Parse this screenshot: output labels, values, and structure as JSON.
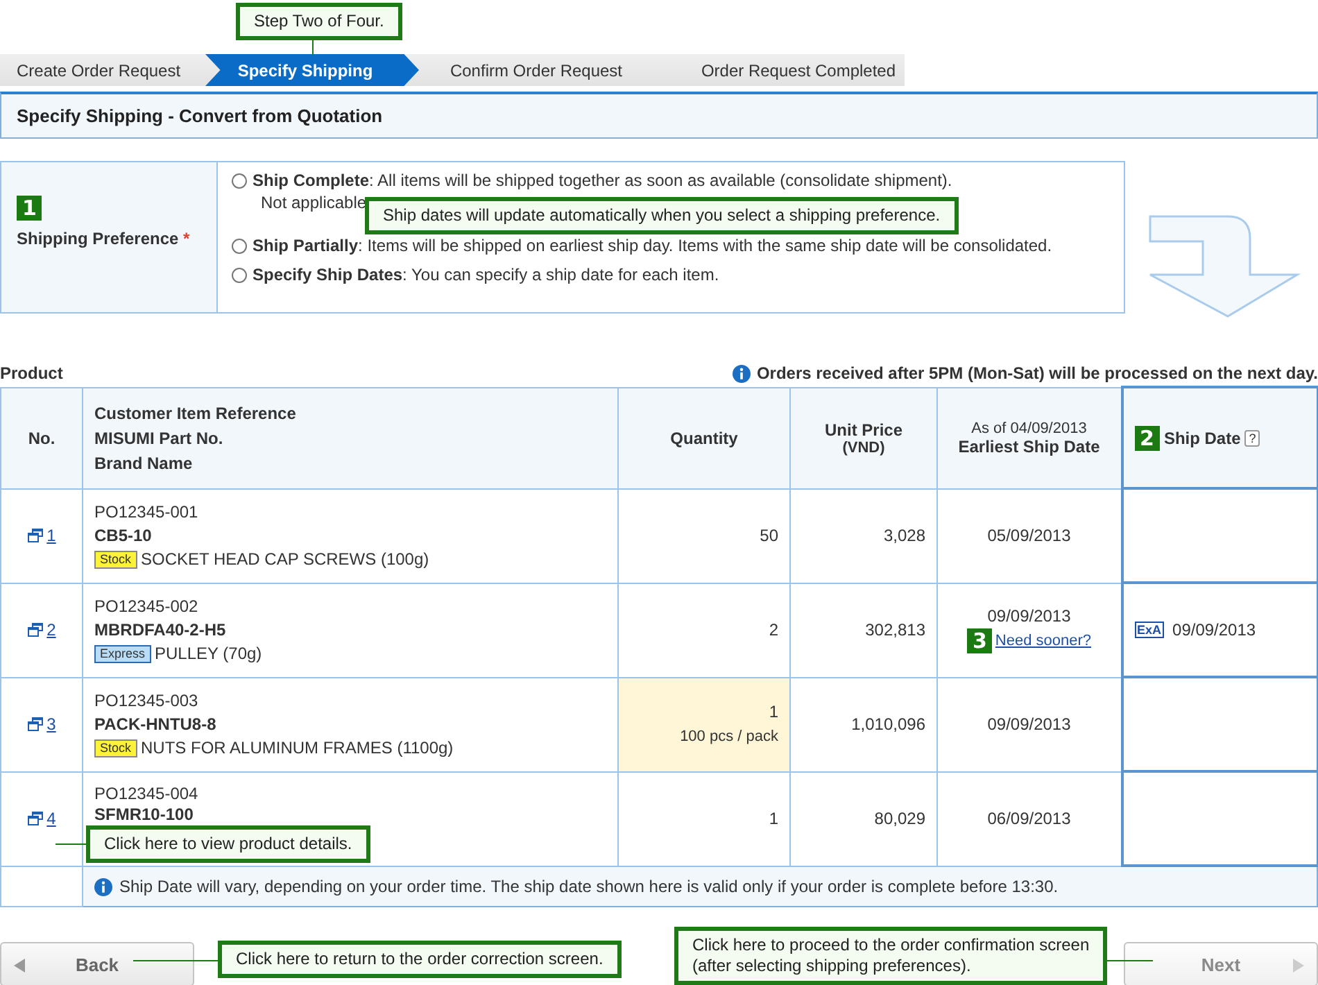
{
  "steps": [
    {
      "label": "Create Order Request",
      "selected": false
    },
    {
      "label": "Specify Shipping",
      "selected": true
    },
    {
      "label": "Confirm Order Request",
      "selected": false
    },
    {
      "label": "Order Request Completed",
      "selected": false
    }
  ],
  "page_title": "Specify Shipping - Convert from Quotation",
  "preference": {
    "marker": "1",
    "label": "Shipping Preference",
    "required_mark": "*",
    "options": [
      {
        "title": "Ship Complete",
        "text": ": All items will be shipped together as soon as available (consolidate shipment).",
        "note": "Not applicable",
        "selected": false
      },
      {
        "title": "Ship Partially",
        "text": ": Items will be shipped on earliest ship day. Items with the same ship date will be consolidated.",
        "selected": false
      },
      {
        "title": "Specify Ship Dates",
        "text": ": You can specify a ship date for each item.",
        "selected": false
      }
    ]
  },
  "product": {
    "title": "Product",
    "notice": "Orders received after 5PM (Mon-Sat) will be processed on the next day.",
    "columns": {
      "no": "No.",
      "item": [
        "Customer Item Reference",
        "MISUMI Part No.",
        "Brand Name"
      ],
      "quantity": "Quantity",
      "price": [
        "Unit Price",
        "(VND)"
      ],
      "earliest": [
        "As of 04/09/2013",
        "Earliest Ship Date"
      ],
      "ship_marker": "2",
      "ship_date": "Ship Date",
      "help": "?"
    },
    "rows": [
      {
        "no": "1",
        "reference": "PO12345-001",
        "part_no": "CB5-10",
        "tag": {
          "label": "Stock",
          "kind": "stock"
        },
        "name": "SOCKET HEAD CAP SCREWS (100g)",
        "quantity": "50",
        "highlighted": false,
        "unit_price": "3,028",
        "earliest": "05/09/2013"
      },
      {
        "no": "2",
        "reference": "PO12345-002",
        "part_no": "MBRDFA40-2-H5",
        "tag": {
          "label": "Express",
          "kind": "express"
        },
        "name": "PULLEY (70g)",
        "quantity": "2",
        "highlighted": false,
        "unit_price": "302,813",
        "earliest": "09/09/2013",
        "sooner_marker": "3",
        "sooner_link": "Need sooner?",
        "ship_badge": "ExA",
        "ship_date": "09/09/2013"
      },
      {
        "no": "3",
        "reference": "PO12345-003",
        "part_no": "PACK-HNTU8-8",
        "tag": {
          "label": "Stock",
          "kind": "stock"
        },
        "name": "NUTS FOR ALUMINUM FRAMES (1100g)",
        "quantity": "1",
        "pack": "100 pcs / pack",
        "highlighted": true,
        "unit_price": "1,010,096",
        "earliest": "09/09/2013"
      },
      {
        "no": "4",
        "reference": "PO12345-004",
        "part_no": "SFMR10-100",
        "quantity": "1",
        "highlighted": false,
        "unit_price": "80,029",
        "earliest": "06/09/2013"
      }
    ],
    "footnote": "Ship Date will vary, depending on your order time. The ship date shown here is valid only if your order is complete before 13:30."
  },
  "buttons": [
    {
      "label": "Back",
      "kind": "back",
      "disabled": false
    },
    {
      "label": "Next",
      "kind": "next",
      "disabled": true
    }
  ],
  "callouts": [
    {
      "kind": "step",
      "text": "Step Two of Four."
    },
    {
      "kind": "preference",
      "text": "Ship dates will update automatically when you select a shipping preference."
    },
    {
      "kind": "product",
      "text": "Click here to view product details."
    },
    {
      "kind": "back",
      "text": "Click here to return to the order correction screen."
    },
    {
      "kind": "next",
      "text": "Click here to proceed to the order confirmation screen\n(after selecting shipping preferences)."
    }
  ]
}
